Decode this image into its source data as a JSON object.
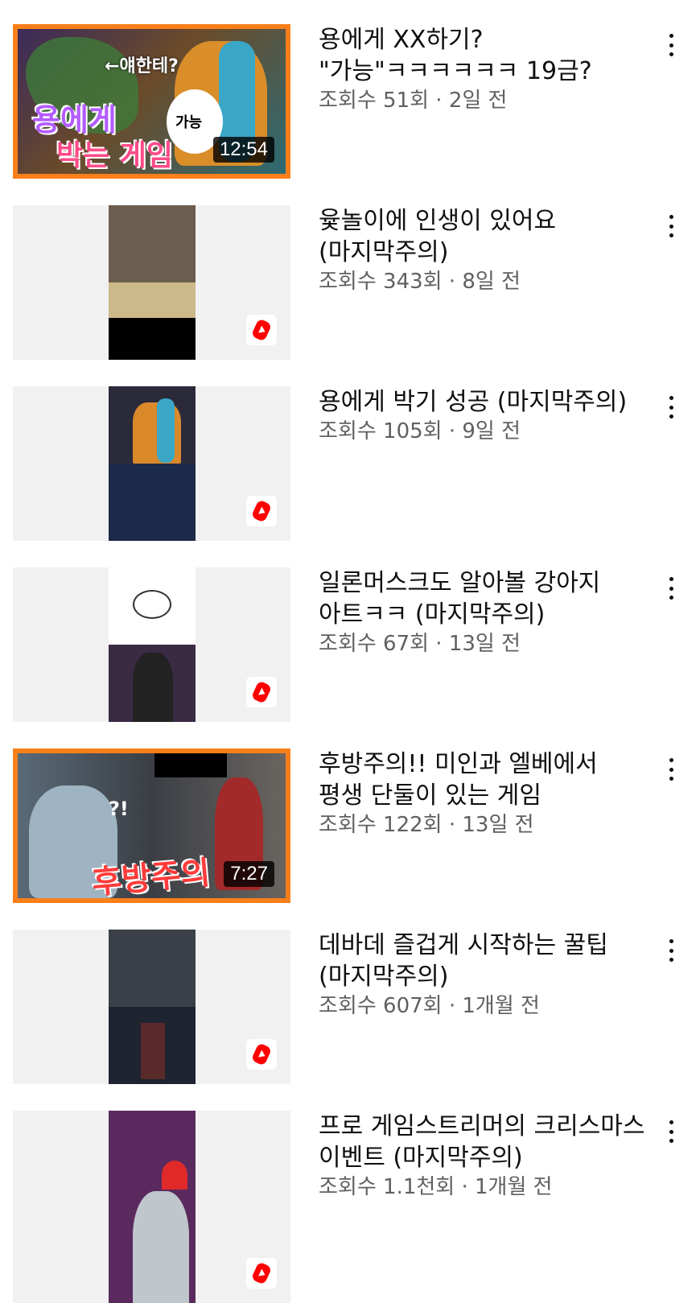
{
  "videos": [
    {
      "title": "용에게 XX하기? \"가능\"ㅋㅋㅋㅋㅋㅋ 19금?",
      "views": "조회수 51회",
      "age": "2일 전",
      "duration": "12:54",
      "type": "long",
      "thumb_text": [
        "용에게",
        "박는 게임",
        "←얘한테?",
        "가능"
      ]
    },
    {
      "title": "윷놀이에 인생이 있어요 (마지막주의)",
      "views": "조회수 343회",
      "age": "8일 전",
      "type": "short"
    },
    {
      "title": "용에게 박기 성공 (마지막주의)",
      "views": "조회수 105회",
      "age": "9일 전",
      "type": "short"
    },
    {
      "title": "일론머스크도 알아볼 강아지 아트ㅋㅋ (마지막주의)",
      "views": "조회수 67회",
      "age": "13일 전",
      "type": "short"
    },
    {
      "title": "후방주의!! 미인과 엘베에서 평생 단둘이 있는 게임",
      "views": "조회수 122회",
      "age": "13일 전",
      "duration": "7:27",
      "type": "long",
      "thumb_text": [
        "후방주의",
        "?!"
      ]
    },
    {
      "title": "데바데 즐겁게 시작하는 꿀팁 (마지막주의)",
      "views": "조회수 607회",
      "age": "1개월 전",
      "type": "short"
    },
    {
      "title": "프로 게임스트리머의 크리스마스 이벤트 (마지막주의)",
      "views": "조회수 1.1천회",
      "age": "1개월 전",
      "type": "short"
    }
  ],
  "separator": " · ",
  "icons": {
    "more": "more-vert-icon",
    "shorts": "shorts-icon"
  },
  "colors": {
    "accent": "#f97f1a",
    "shorts_red": "#ff0000",
    "meta_gray": "#606060"
  }
}
